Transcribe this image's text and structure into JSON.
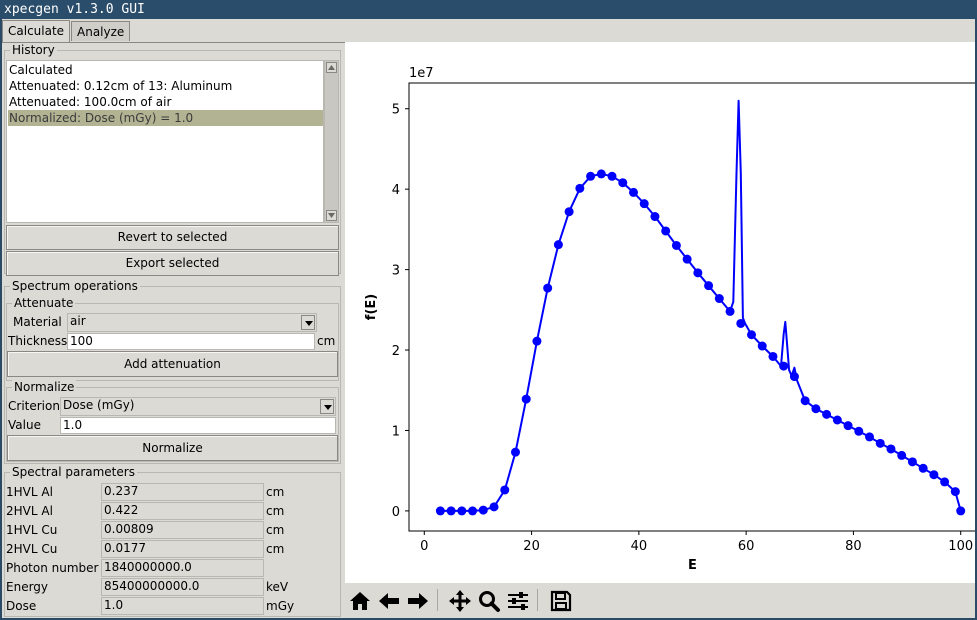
{
  "window": {
    "title": "xpecgen v1.3.0 GUI"
  },
  "tabs": [
    {
      "label": "Calculate",
      "selected": true
    },
    {
      "label": "Analyze",
      "selected": false
    }
  ],
  "history": {
    "label": "History",
    "items": [
      {
        "text": "Calculated",
        "selected": false
      },
      {
        "text": "Attenuated: 0.12cm of 13: Aluminum",
        "selected": false
      },
      {
        "text": "Attenuated: 100.0cm of air",
        "selected": false
      },
      {
        "text": "Normalized: Dose (mGy) = 1.0",
        "selected": true
      }
    ],
    "revert_label": "Revert to selected",
    "export_label": "Export selected"
  },
  "spectrum_ops": {
    "label": "Spectrum operations",
    "attenuate": {
      "label": "Attenuate",
      "material_label": "Material",
      "material_value": "air",
      "thickness_label": "Thickness",
      "thickness_value": "100",
      "thickness_unit": "cm",
      "button_label": "Add attenuation"
    },
    "normalize": {
      "label": "Normalize",
      "criterion_label": "Criterion",
      "criterion_value": "Dose (mGy)",
      "value_label": "Value",
      "value_value": "1.0",
      "button_label": "Normalize"
    }
  },
  "spectral_params": {
    "label": "Spectral parameters",
    "rows": [
      {
        "label": "1HVL Al",
        "value": "0.237",
        "unit": "cm"
      },
      {
        "label": "2HVL Al",
        "value": "0.422",
        "unit": "cm"
      },
      {
        "label": "1HVL Cu",
        "value": "0.00809",
        "unit": "cm"
      },
      {
        "label": "2HVL Cu",
        "value": "0.0177",
        "unit": "cm"
      },
      {
        "label": "Photon number",
        "value": "1840000000.0",
        "unit": ""
      },
      {
        "label": "Energy",
        "value": "85400000000.0",
        "unit": "keV"
      },
      {
        "label": "Dose",
        "value": "1.0",
        "unit": "mGy"
      }
    ]
  },
  "toolbar": {
    "icons": [
      "home-icon",
      "back-arrow-icon",
      "forward-arrow-icon",
      "pan-icon",
      "zoom-icon",
      "configure-subplots-icon",
      "save-icon"
    ]
  },
  "colors": {
    "line": "#0000ff",
    "selection": "#b1b393",
    "titlebar": "#2b4d6c"
  },
  "chart_data": {
    "type": "line",
    "title": "",
    "xlabel": "E",
    "ylabel": "f(E)",
    "offset_text": "1e7",
    "xlim": [
      -2.85,
      102.85
    ],
    "ylim": [
      -0.25,
      5.32
    ],
    "xticks": [
      0,
      20,
      40,
      60,
      80,
      100
    ],
    "yticks": [
      0,
      1,
      2,
      3,
      4,
      5
    ],
    "series": [
      {
        "style": "line",
        "x": [
          3,
          5,
          7,
          9,
          11,
          13,
          15,
          17,
          19,
          21,
          23,
          25,
          27,
          29,
          31,
          33,
          35,
          37,
          39,
          41,
          43,
          45,
          47,
          49,
          51,
          53,
          55,
          57,
          57.6,
          58.2,
          58.6,
          59.0,
          59.4,
          59.8,
          61,
          63,
          65,
          66.5,
          67.0,
          67.3,
          67.6,
          68,
          68.5,
          69,
          69.5,
          71,
          73,
          75,
          77,
          79,
          81,
          83,
          85,
          87,
          89,
          91,
          93,
          95,
          97,
          99,
          100
        ],
        "y": [
          0,
          0,
          0,
          0,
          0.01,
          0.05,
          0.26,
          0.73,
          1.39,
          2.11,
          2.77,
          3.31,
          3.72,
          4.01,
          4.16,
          4.19,
          4.16,
          4.08,
          3.96,
          3.82,
          3.66,
          3.48,
          3.3,
          3.13,
          2.96,
          2.8,
          2.64,
          2.48,
          2.6,
          4.2,
          5.1,
          4.2,
          2.4,
          2.33,
          2.19,
          2.05,
          1.92,
          1.8,
          2.2,
          2.35,
          2.1,
          1.75,
          1.68,
          1.78,
          1.62,
          1.37,
          1.27,
          1.2,
          1.13,
          1.06,
          0.99,
          0.92,
          0.84,
          0.77,
          0.69,
          0.61,
          0.53,
          0.45,
          0.36,
          0.24,
          0.0
        ]
      },
      {
        "style": "markers",
        "x": [
          3,
          5,
          7,
          9,
          11,
          13,
          15,
          17,
          19,
          21,
          23,
          25,
          27,
          29,
          31,
          33,
          35,
          37,
          39,
          41,
          43,
          45,
          47,
          49,
          51,
          53,
          55,
          57,
          59,
          61,
          63,
          65,
          67,
          69,
          71,
          73,
          75,
          77,
          79,
          81,
          83,
          85,
          87,
          89,
          91,
          93,
          95,
          97,
          99,
          100
        ],
        "y": [
          0,
          0,
          0,
          0,
          0.01,
          0.05,
          0.26,
          0.73,
          1.39,
          2.11,
          2.77,
          3.31,
          3.72,
          4.01,
          4.16,
          4.19,
          4.16,
          4.08,
          3.96,
          3.82,
          3.66,
          3.48,
          3.3,
          3.13,
          2.96,
          2.8,
          2.64,
          2.48,
          2.33,
          2.19,
          2.05,
          1.92,
          1.8,
          1.67,
          1.37,
          1.27,
          1.2,
          1.13,
          1.06,
          0.99,
          0.92,
          0.84,
          0.77,
          0.69,
          0.61,
          0.53,
          0.45,
          0.36,
          0.24,
          0.0
        ]
      }
    ]
  }
}
